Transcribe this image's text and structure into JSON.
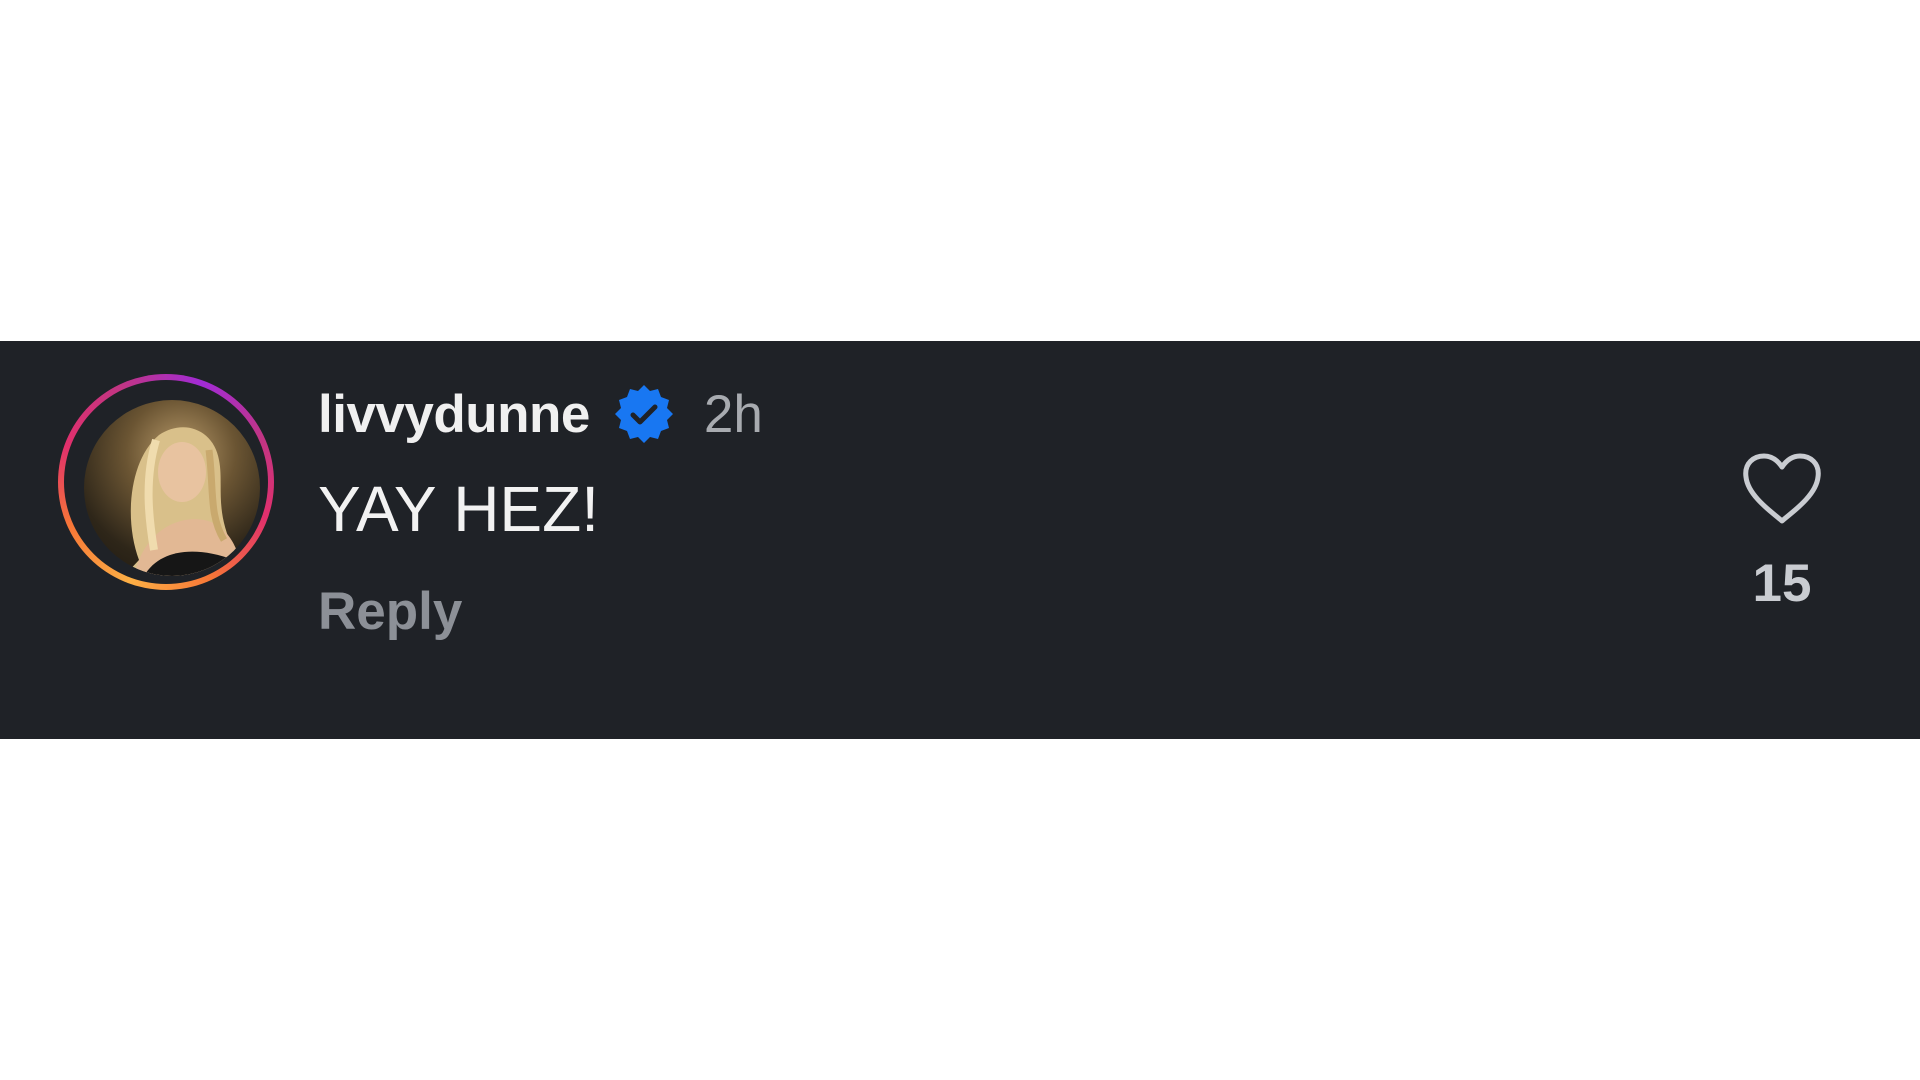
{
  "comment": {
    "username": "livvydunne",
    "verified_icon": "verified-badge-icon",
    "time": "2h",
    "text": "YAY HEZ!",
    "reply_label": "Reply",
    "like_icon": "heart-outline-icon",
    "like_count": "15"
  },
  "colors": {
    "background": "#1f2227",
    "verified": "#1877f2",
    "muted_text": "#8c9097"
  }
}
